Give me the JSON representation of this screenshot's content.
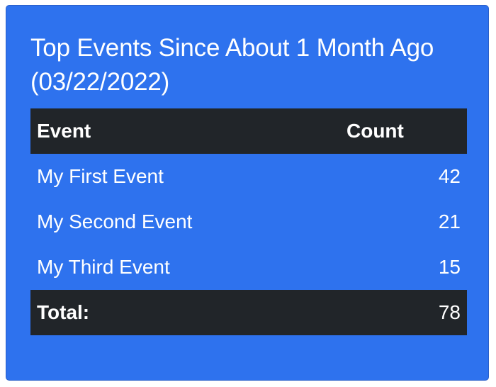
{
  "card": {
    "title": "Top Events Since About 1 Month Ago (03/22/2022)",
    "background_color": "#2e72ee",
    "header_color": "#212529"
  },
  "table": {
    "headers": {
      "event": "Event",
      "count": "Count"
    },
    "rows": [
      {
        "event": "My First Event",
        "count": "42"
      },
      {
        "event": "My Second Event",
        "count": "21"
      },
      {
        "event": "My Third Event",
        "count": "15"
      }
    ],
    "footer": {
      "label": "Total:",
      "count": "78"
    }
  }
}
